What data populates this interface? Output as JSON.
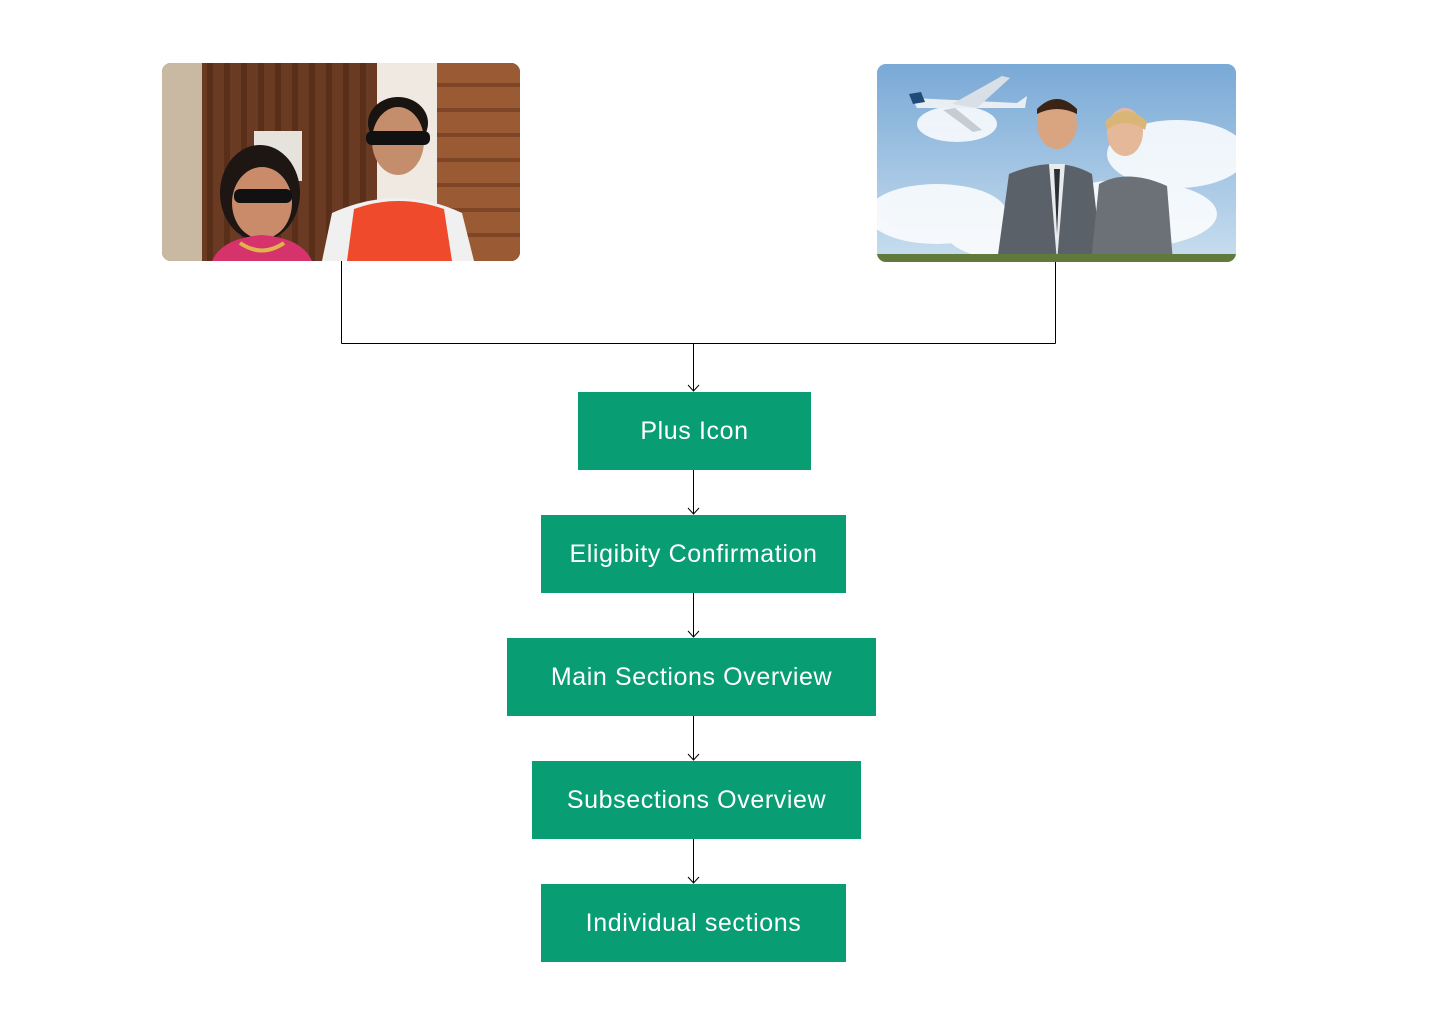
{
  "images": [
    {
      "name": "family-photo",
      "description_icon": "people-with-sunglasses-photo"
    },
    {
      "name": "travel-photo",
      "description_icon": "couple-with-airplane-photo"
    }
  ],
  "flow": {
    "steps": [
      {
        "label": "Plus Icon"
      },
      {
        "label": "Eligibity Confirmation"
      },
      {
        "label": "Main Sections Overview"
      },
      {
        "label": "Subsections Overview"
      },
      {
        "label": "Individual sections"
      }
    ]
  },
  "colors": {
    "box_fill": "#099d73",
    "box_text": "#ffffff",
    "connector": "#000000"
  }
}
